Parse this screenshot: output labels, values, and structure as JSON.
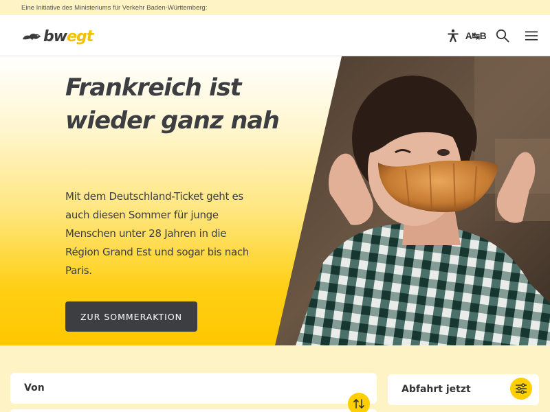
{
  "topbar": {
    "text": "Eine Initiative des Ministeriums für Verkehr Baden-Württemberg:"
  },
  "header": {
    "logo": {
      "part1": "bw",
      "part2": "egt"
    },
    "icons": [
      "accessibility-icon",
      "language-icon",
      "search-icon",
      "menu-icon"
    ],
    "language_label": "A↹B"
  },
  "hero": {
    "title": "Frankreich ist wieder ganz nah",
    "text": "Mit dem Deutschland-Ticket geht es auch diesen Sommer für junge Menschen unter 28 Jahren in die Région Grand Est und sogar bis nach Paris.",
    "cta": "ZUR SOMMERAKTION"
  },
  "search": {
    "from_label": "Von",
    "time_label": "Abfahrt jetzt"
  },
  "colors": {
    "accent": "#ffcf00",
    "dark": "#3c3e42",
    "background": "#fdf3c4"
  }
}
